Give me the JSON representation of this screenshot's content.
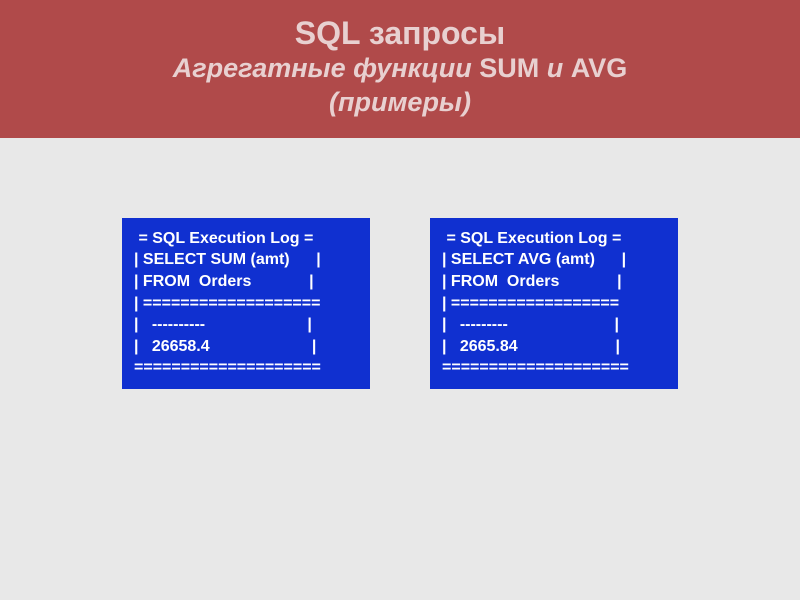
{
  "header": {
    "line1": "SQL запросы",
    "line2_italic_pre": "Агрегатные функции ",
    "line2_sum": "SUM",
    "line2_i": " и ",
    "line2_avg": "AVG",
    "line3": "(примеры)"
  },
  "log_left": {
    "r1": " = SQL Execution Log =",
    "r2": "| SELECT SUM (amt)      |",
    "r3": "| FROM  Orders             |",
    "r4": "| ===================",
    "r5": "|   ----------                       |",
    "r6": "|   26658.4                       |",
    "r7": "===================="
  },
  "log_right": {
    "r1": " = SQL Execution Log =",
    "r2": "| SELECT AVG (amt)      |",
    "r3": "| FROM  Orders             |",
    "r4": "| ==================",
    "r5": "|   ---------                        |",
    "r6": "|   2665.84                      |",
    "r7": "===================="
  }
}
